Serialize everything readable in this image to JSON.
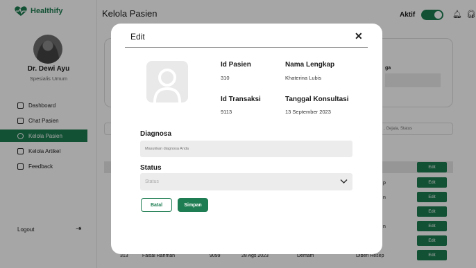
{
  "app": {
    "logo_text": "Healthify"
  },
  "profile": {
    "name": "Dr. Dewi Ayu",
    "role": "Spesialis Umum"
  },
  "sidebar": {
    "items": [
      {
        "label": "Dashboard",
        "icon": "dashboard-icon"
      },
      {
        "label": "Chat Pasien",
        "icon": "chat-icon"
      },
      {
        "label": "Kelola Pasien",
        "icon": "users-icon",
        "active": true
      },
      {
        "label": "Kelola Artikel",
        "icon": "article-icon"
      },
      {
        "label": "Feedback",
        "icon": "feedback-icon"
      }
    ],
    "logout_label": "Logout"
  },
  "header": {
    "title": "Kelola Pasien",
    "status_label": "Aktif",
    "status_on": true
  },
  "background": {
    "card_label": "ga",
    "search_hint": ", Gejala, Status",
    "edit_label": "Edit",
    "visible_cells": [
      "p",
      "n",
      "n"
    ],
    "last_row": [
      "313",
      "Faisal Rahman",
      "9099",
      "28 Ags 2023",
      "Demam",
      "Diberi Resep"
    ]
  },
  "modal": {
    "title": "Edit",
    "close_icon": "close-icon",
    "id_pasien_label": "Id Pasien",
    "id_pasien_value": "310",
    "nama_label": "Nama Lengkap",
    "nama_value": "Khaterina Lubis",
    "id_transaksi_label": "Id Transaksi",
    "id_transaksi_value": "9113",
    "tanggal_label": "Tanggal Konsultasi",
    "tanggal_value": "13 September 2023",
    "diagnosa_label": "Diagnosa",
    "diagnosa_placeholder": "Masukkan diagnosa Anda",
    "status_label": "Status",
    "status_placeholder": "Status",
    "cancel_label": "Batal",
    "save_label": "Simpan"
  },
  "colors": {
    "primary": "#1e7d52"
  }
}
